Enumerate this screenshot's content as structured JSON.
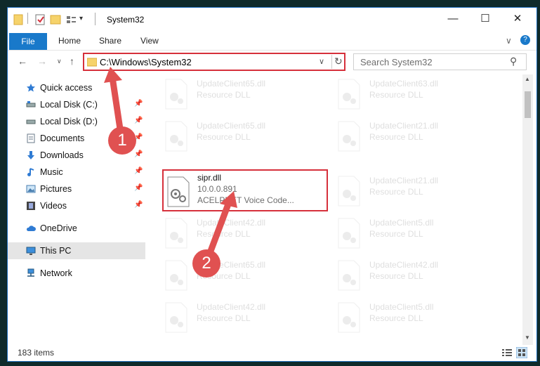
{
  "window": {
    "title": "System32",
    "controls": {
      "minimize": "—",
      "maximize": "☐",
      "close": "✕"
    }
  },
  "ribbon": {
    "tabs": [
      {
        "label": "File"
      },
      {
        "label": "Home"
      },
      {
        "label": "Share"
      },
      {
        "label": "View"
      }
    ],
    "expand_glyph": "∨",
    "help_glyph": "?"
  },
  "navigation": {
    "back": "←",
    "forward": "→",
    "recent": "∨",
    "up": "↑",
    "address_path": "C:\\Windows\\System32",
    "address_dropdown": "∨",
    "refresh": "↻",
    "search_placeholder": "Search System32",
    "search_icon": "⚲"
  },
  "sidebar": {
    "items": [
      {
        "label": "Quick access",
        "icon": "star-icon",
        "pinned": false
      },
      {
        "label": "Local Disk (C:)",
        "icon": "drive-icon",
        "pinned": true
      },
      {
        "label": "Local Disk (D:)",
        "icon": "drive-icon",
        "pinned": true
      },
      {
        "label": "Documents",
        "icon": "documents-icon",
        "pinned": true
      },
      {
        "label": "Downloads",
        "icon": "downloads-icon",
        "pinned": true
      },
      {
        "label": "Music",
        "icon": "music-icon",
        "pinned": true
      },
      {
        "label": "Pictures",
        "icon": "pictures-icon",
        "pinned": true
      },
      {
        "label": "Videos",
        "icon": "videos-icon",
        "pinned": true
      },
      {
        "label": "OneDrive",
        "icon": "cloud-icon",
        "pinned": false
      },
      {
        "label": "This PC",
        "icon": "pc-icon",
        "pinned": false,
        "selected": true
      },
      {
        "label": "Network",
        "icon": "network-icon",
        "pinned": false
      }
    ],
    "pin_glyph": "📌"
  },
  "files": [
    {
      "name": "UpdateClient65.dll",
      "desc": "Resource DLL"
    },
    {
      "name": "UpdateClient63.dll",
      "desc": "Resource DLL"
    },
    {
      "name": "UpdateClient65.dll",
      "desc": "Resource DLL"
    },
    {
      "name": "UpdateClient21.dll",
      "desc": "Resource DLL"
    },
    {
      "name": "sipr.dll",
      "desc": "10.0.0.891",
      "company": "ACELPNET Voice Code..."
    },
    {
      "name": "UpdateClient21.dll",
      "desc": "Resource DLL"
    },
    {
      "name": "UpdateClient42.dll",
      "desc": "Resource DLL"
    },
    {
      "name": "UpdateClient5.dll",
      "desc": "Resource DLL"
    },
    {
      "name": "UpdateClient65.dll",
      "desc": "Resource DLL"
    },
    {
      "name": "UpdateClient42.dll",
      "desc": "Resource DLL"
    },
    {
      "name": "UpdateClient42.dll",
      "desc": "Resource DLL"
    },
    {
      "name": "UpdateClient5.dll",
      "desc": "Resource DLL"
    }
  ],
  "status": {
    "item_count": "183 items"
  },
  "annotations": {
    "step1": "1",
    "step2": "2",
    "color": "#e05151"
  }
}
